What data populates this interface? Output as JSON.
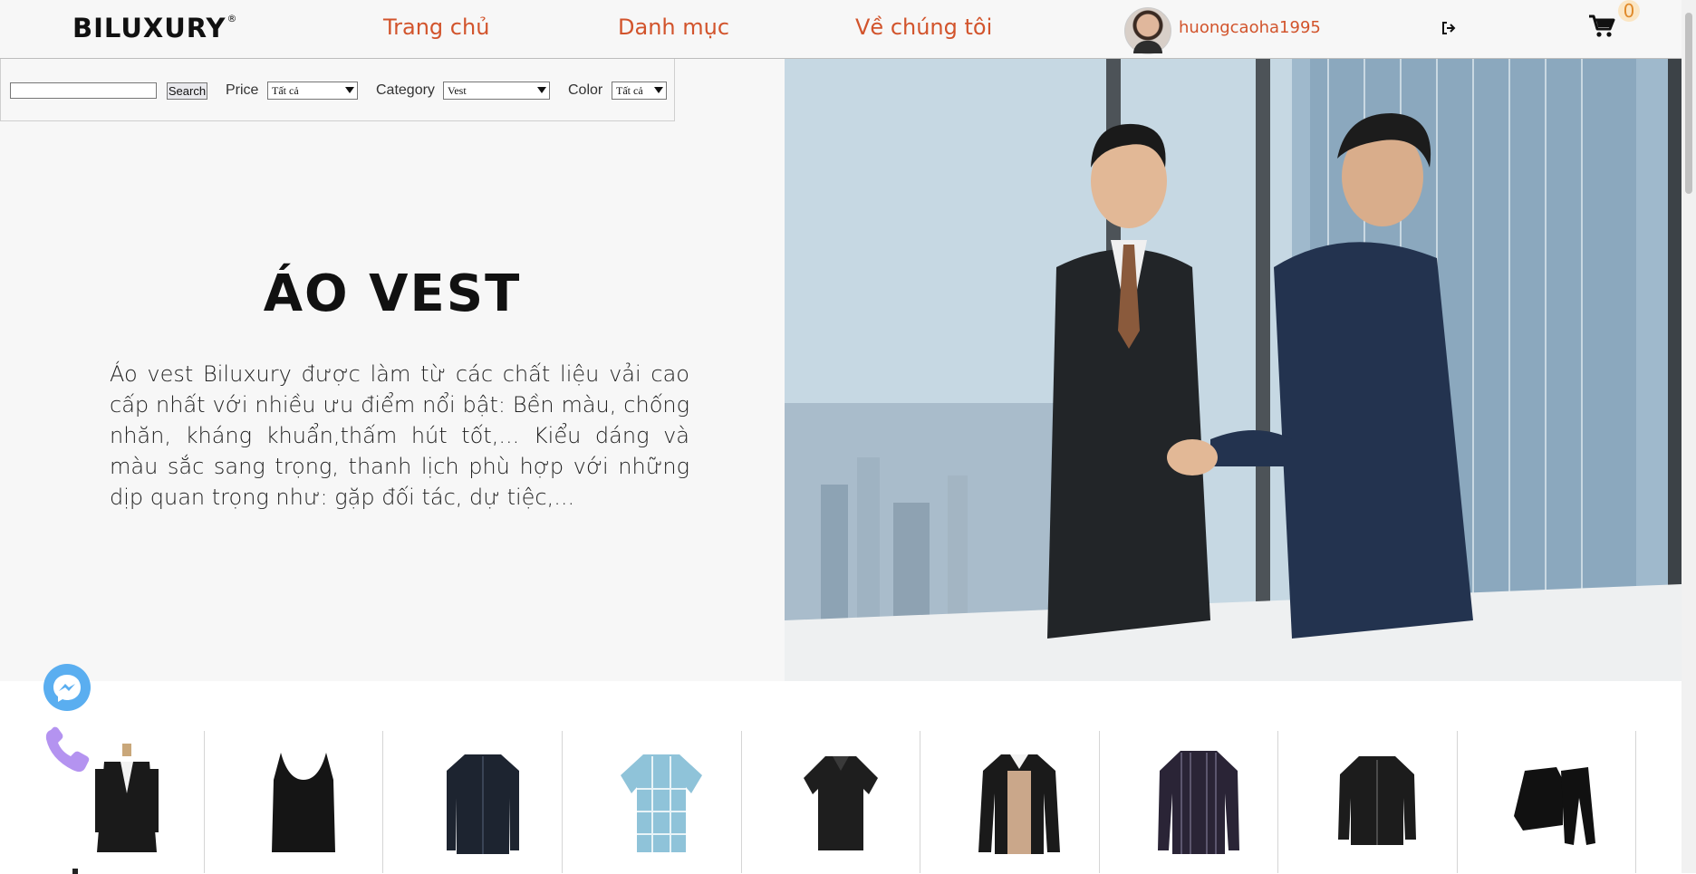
{
  "header": {
    "logo_text": "BILUXURY",
    "logo_mark": "®",
    "nav": [
      "Trang chủ",
      "Danh mục",
      "Về chúng tôi"
    ],
    "username": "huongcaoha1995",
    "cart_count": "0"
  },
  "filters": {
    "search_value": "",
    "search_button": "Search",
    "price_label": "Price",
    "price_value": "Tất cả",
    "category_label": "Category",
    "category_value": "Vest",
    "color_label": "Color",
    "color_value": "Tất cả"
  },
  "hero": {
    "title": "ÁO VEST",
    "description": "Áo vest Biluxury được làm từ các chất liệu vải cao cấp nhất với nhiều ưu điểm nổi bật: Bền màu, chống nhăn, kháng khuẩn,thấm hút tốt,... Kiểu dáng và màu sắc sang trọng, thanh lịch phù hợp với những dịp quan trọng như: gặp đối tác, dự tiệc,..."
  },
  "products": [
    {
      "icon": "suit-icon",
      "color": "#1a1a1a"
    },
    {
      "icon": "tank-top-icon",
      "color": "#151515"
    },
    {
      "icon": "shirt-icon",
      "color": "#1d2430"
    },
    {
      "icon": "plaid-shirt-icon",
      "color": "#8fc3d9"
    },
    {
      "icon": "polo-icon",
      "color": "#1e1e1e"
    },
    {
      "icon": "polo-long-icon",
      "color": "#caa78a"
    },
    {
      "icon": "striped-shirt-icon",
      "color": "#2a2436"
    },
    {
      "icon": "jacket-icon",
      "color": "#1c1c1c"
    },
    {
      "icon": "tracksuit-icon",
      "color": "#111111"
    }
  ],
  "colors": {
    "accent": "#d2542c",
    "messenger": "#5aaef0",
    "phone": "#b493f0"
  }
}
